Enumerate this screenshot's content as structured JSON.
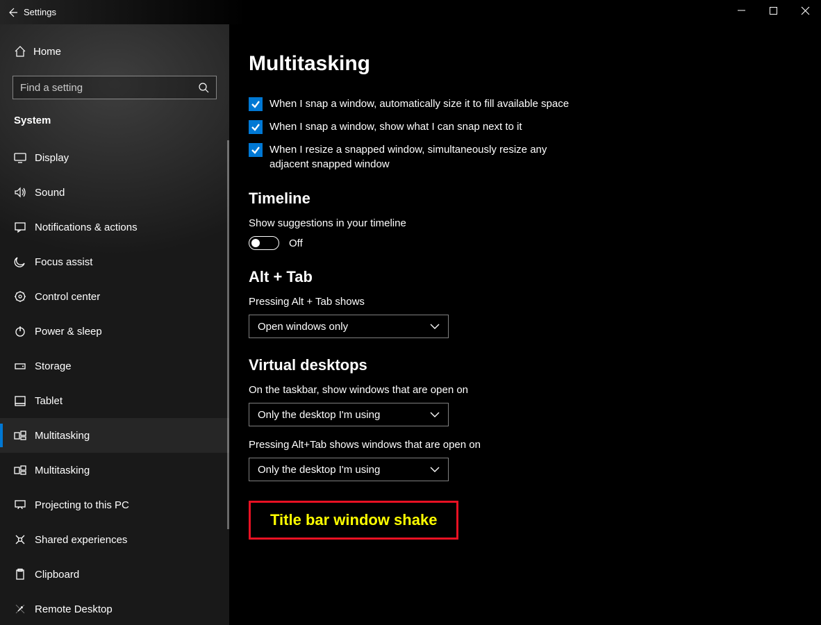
{
  "app_title": "Settings",
  "window_buttons": {
    "min": "Minimize",
    "max": "Maximize",
    "close": "Close"
  },
  "search": {
    "placeholder": "Find a setting"
  },
  "home_label": "Home",
  "section_label": "System",
  "nav": [
    {
      "icon": "display-icon",
      "label": "Display"
    },
    {
      "icon": "sound-icon",
      "label": "Sound"
    },
    {
      "icon": "notifications-icon",
      "label": "Notifications & actions"
    },
    {
      "icon": "focus-icon",
      "label": "Focus assist"
    },
    {
      "icon": "controlcenter-icon",
      "label": "Control center"
    },
    {
      "icon": "power-icon",
      "label": "Power & sleep"
    },
    {
      "icon": "storage-icon",
      "label": "Storage"
    },
    {
      "icon": "tablet-icon",
      "label": "Tablet"
    },
    {
      "icon": "multitasking-icon",
      "label": "Multitasking"
    },
    {
      "icon": "multitasking-icon",
      "label": "Multitasking"
    },
    {
      "icon": "projecting-icon",
      "label": "Projecting to this PC"
    },
    {
      "icon": "shared-icon",
      "label": "Shared experiences"
    },
    {
      "icon": "clipboard-icon",
      "label": "Clipboard"
    },
    {
      "icon": "remote-icon",
      "label": "Remote Desktop"
    }
  ],
  "active_nav_index": 8,
  "page_title": "Multitasking",
  "checks": [
    "When I snap a window, automatically size it to fill available space",
    "When I snap a window, show what I can snap next to it",
    "When I resize a snapped window, simultaneously resize any adjacent snapped window"
  ],
  "timeline": {
    "heading": "Timeline",
    "label": "Show suggestions in your timeline",
    "toggle_value": "Off"
  },
  "alttab": {
    "heading": "Alt + Tab",
    "label": "Pressing Alt + Tab shows",
    "value": "Open windows only"
  },
  "virtual": {
    "heading": "Virtual desktops",
    "opt1_label": "On the taskbar, show windows that are open on",
    "opt1_value": "Only the desktop I'm using",
    "opt2_label": "Pressing Alt+Tab shows windows that are open on",
    "opt2_value": "Only the desktop I'm using"
  },
  "highlighted_heading": "Title bar window shake"
}
